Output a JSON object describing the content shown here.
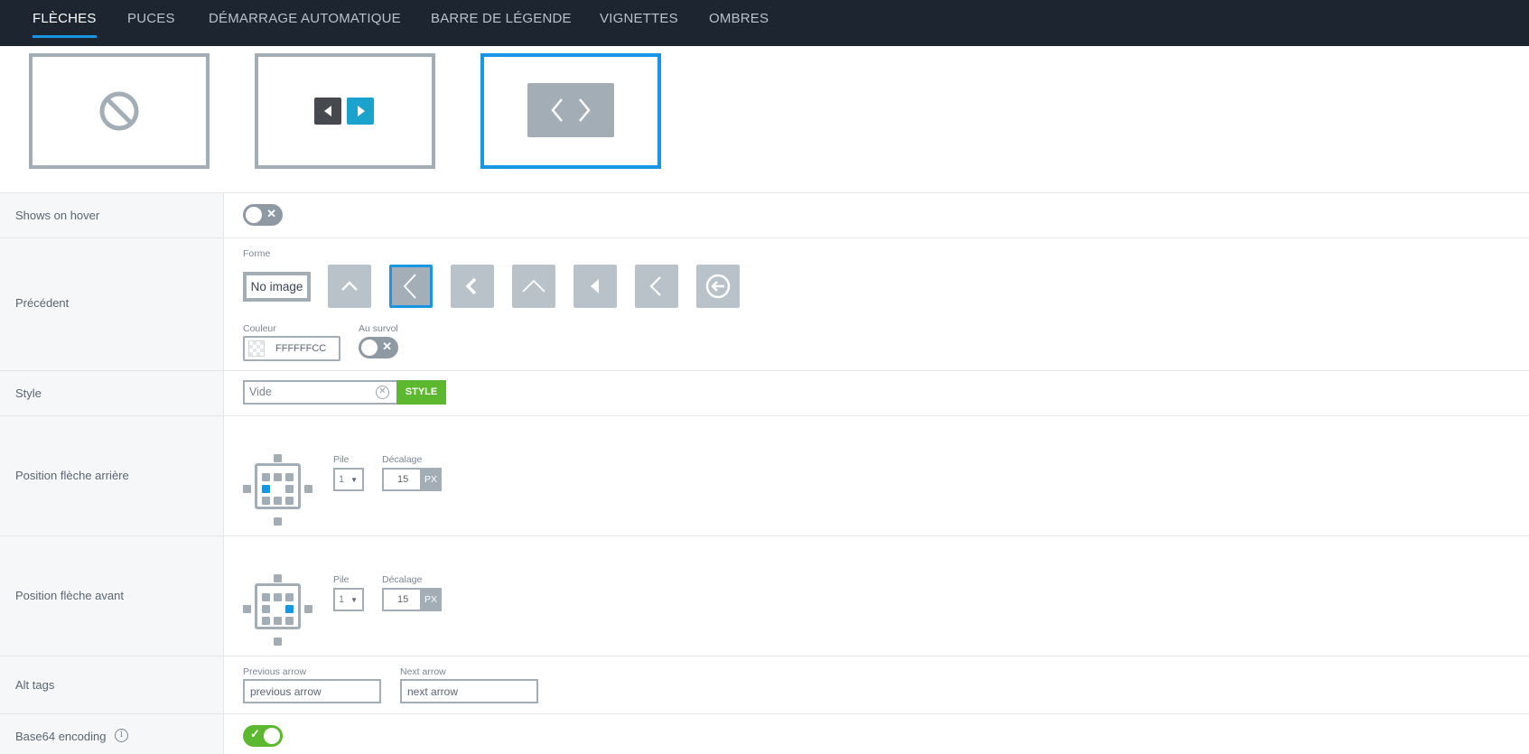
{
  "tabs": [
    {
      "label": "FLÈCHES",
      "active": true
    },
    {
      "label": "PUCES",
      "active": false
    },
    {
      "label": "DÉMARRAGE AUTOMATIQUE",
      "active": false
    },
    {
      "label": "BARRE DE LÉGENDE",
      "active": false
    },
    {
      "label": "VIGNETTES",
      "active": false
    },
    {
      "label": "OMBRES",
      "active": false
    }
  ],
  "arrow_types": {
    "selected_index": 2,
    "items": [
      "none-icon",
      "small-arrow-buttons-icon",
      "chevron-pair-icon"
    ]
  },
  "rows": {
    "shows_on_hover": {
      "label": "Shows on hover",
      "enabled": false
    },
    "previous": {
      "label": "Précédent",
      "shape_label": "Forme",
      "no_image_label": "No image",
      "selected_shape_index": 1,
      "shapes": [
        "chevron-up-icon",
        "thin-chevron-left-icon",
        "bold-chevron-left-icon",
        "thin-chevron-up-icon",
        "triangle-left-icon",
        "chevron-left-icon",
        "circle-arrow-left-icon"
      ],
      "color_label": "Couleur",
      "color_value": "FFFFFFCC",
      "hover_label": "Au survol",
      "hover_enabled": false
    },
    "style": {
      "label": "Style",
      "placeholder": "Vide",
      "button": "STYLE"
    },
    "back_position": {
      "label": "Position flèche arrière",
      "stack_label": "Pile",
      "stack_value": "1",
      "offset_label": "Décalage",
      "offset_value": "15",
      "unit": "PX",
      "selected_cell": "middle-left"
    },
    "front_position": {
      "label": "Position flèche avant",
      "stack_label": "Pile",
      "stack_value": "1",
      "offset_label": "Décalage",
      "offset_value": "15",
      "unit": "PX",
      "selected_cell": "middle-right"
    },
    "alt_tags": {
      "label": "Alt tags",
      "prev_label": "Previous arrow",
      "prev_value": "previous arrow",
      "next_label": "Next arrow",
      "next_value": "next arrow"
    },
    "base64": {
      "label": "Base64 encoding",
      "enabled": true
    }
  },
  "colors": {
    "accent": "#1896e4",
    "topbar": "#1c2530",
    "success": "#5cb82f"
  }
}
